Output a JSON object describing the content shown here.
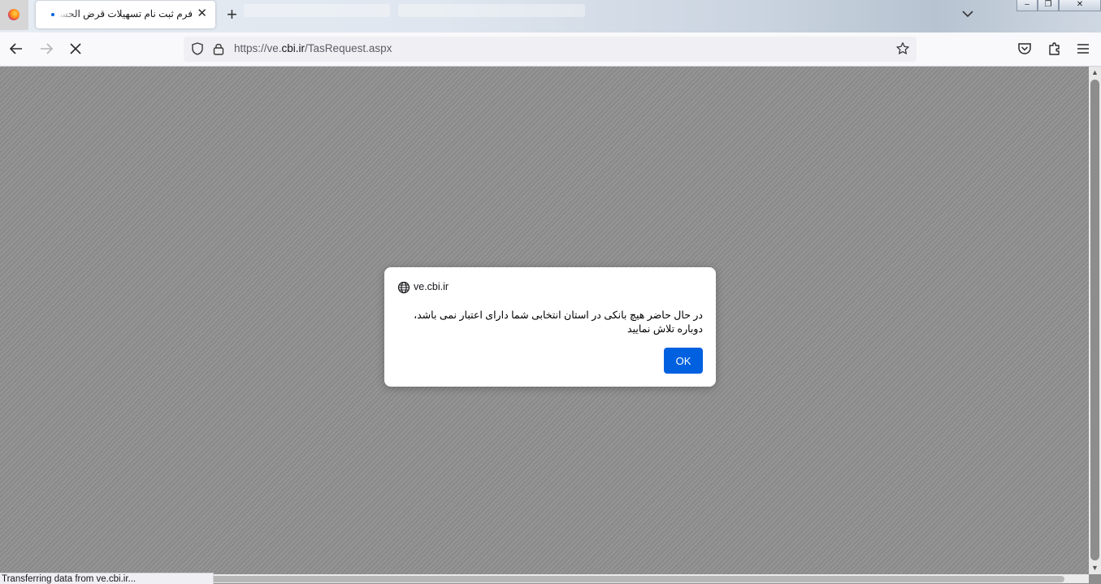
{
  "browser": {
    "tab": {
      "title": "فرم ثبت نام تسهیلات قرض الحسنه ازدواج",
      "close_glyph": "✕"
    },
    "new_tab_glyph": "+",
    "url": {
      "prefix": "https://ve.",
      "domain": "cbi.ir",
      "path": "/TasRequest.aspx"
    },
    "window_controls": {
      "minimize": "–",
      "restore": "❐",
      "close": "✕"
    }
  },
  "dialog": {
    "origin": "ve.cbi.ir",
    "message": "در حال حاضر هیچ بانکی در استان انتخابی شما دارای اعتبار نمی باشد، دوباره تلاش نمایید",
    "ok_label": "OK"
  },
  "status_bar": {
    "text": "Transferring data from ve.cbi.ir..."
  },
  "colors": {
    "accent": "#0061e0",
    "overlay": "#8f8f8f"
  }
}
